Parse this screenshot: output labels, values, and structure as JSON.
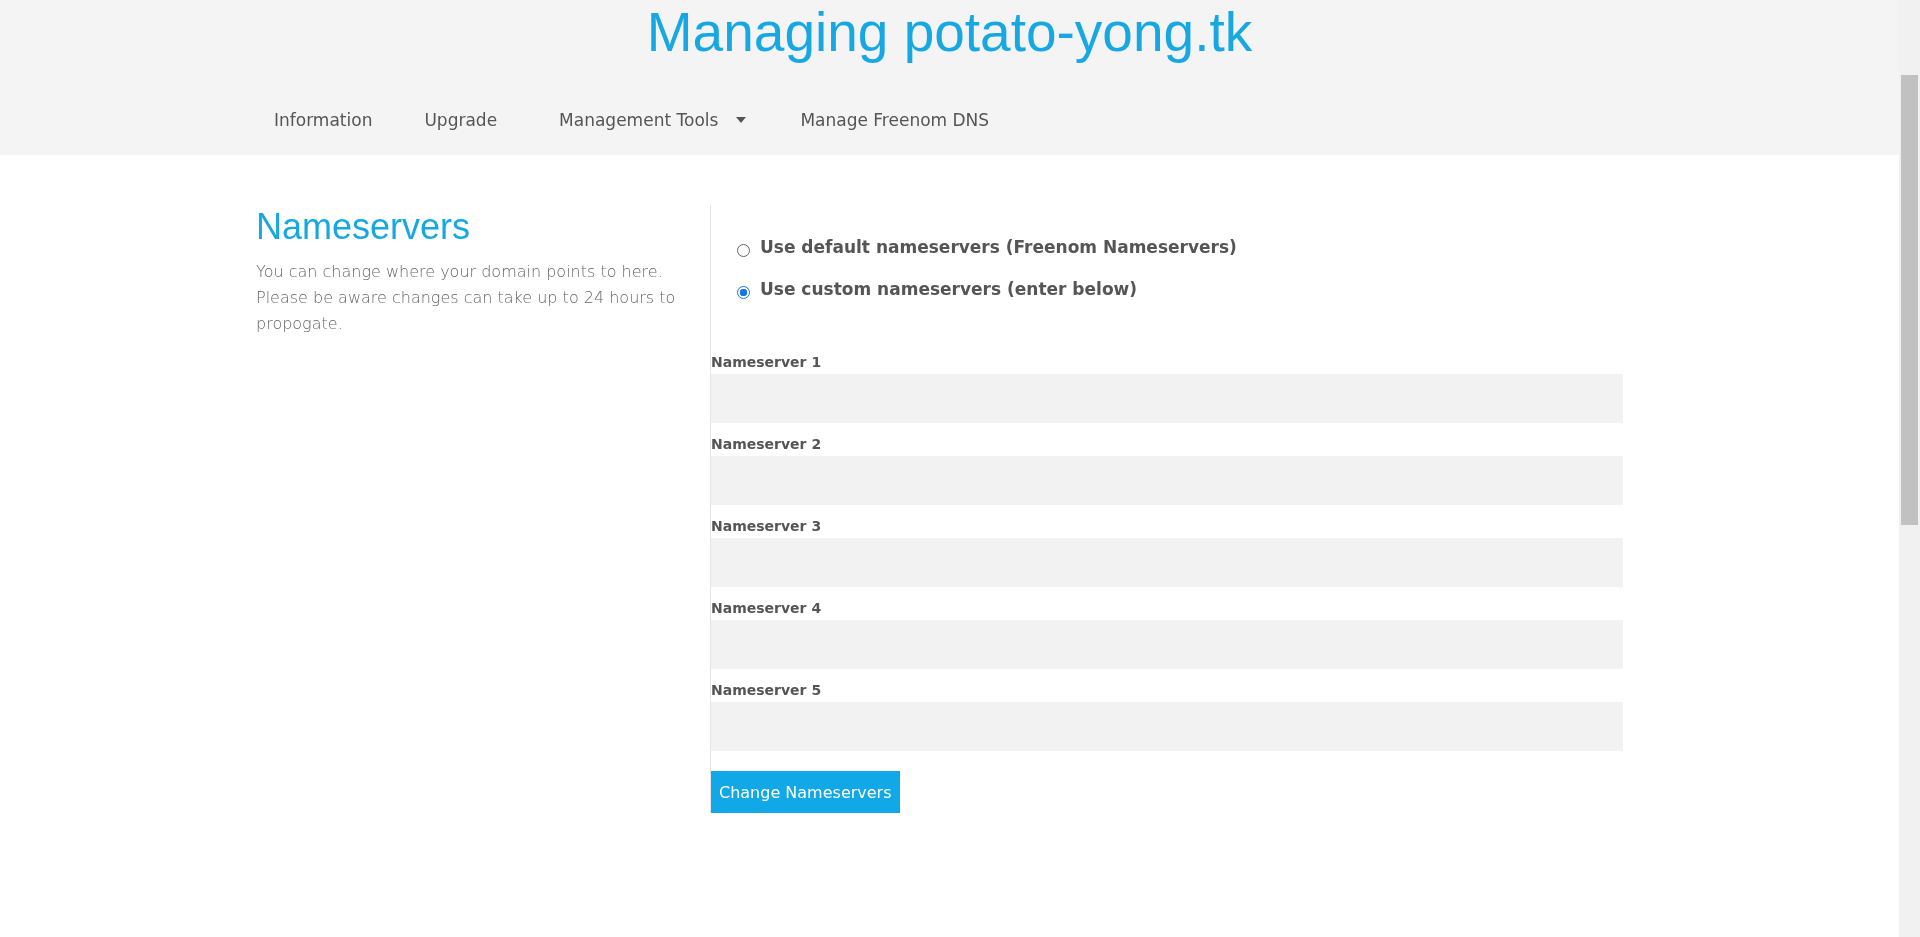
{
  "header": {
    "title": "Managing potato-yong.tk"
  },
  "nav": [
    {
      "label": "Information",
      "kind": "link"
    },
    {
      "label": "Upgrade",
      "kind": "link"
    },
    {
      "label": "Management Tools",
      "kind": "dropdown"
    },
    {
      "label": "Manage Freenom DNS",
      "kind": "link"
    }
  ],
  "section": {
    "heading": "Nameservers",
    "description": "You can change where your domain points to here. Please be aware changes can take up to 24 hours to propogate."
  },
  "options": [
    {
      "label": "Use default nameservers (Freenom Nameservers)",
      "selected": false
    },
    {
      "label": "Use custom nameservers (enter below)",
      "selected": true
    }
  ],
  "fields": [
    {
      "label": "Nameserver 1"
    },
    {
      "label": "Nameserver 2"
    },
    {
      "label": "Nameserver 3"
    },
    {
      "label": "Nameserver 4"
    },
    {
      "label": "Nameserver 5"
    }
  ],
  "submit": {
    "label": "Change Nameservers"
  }
}
